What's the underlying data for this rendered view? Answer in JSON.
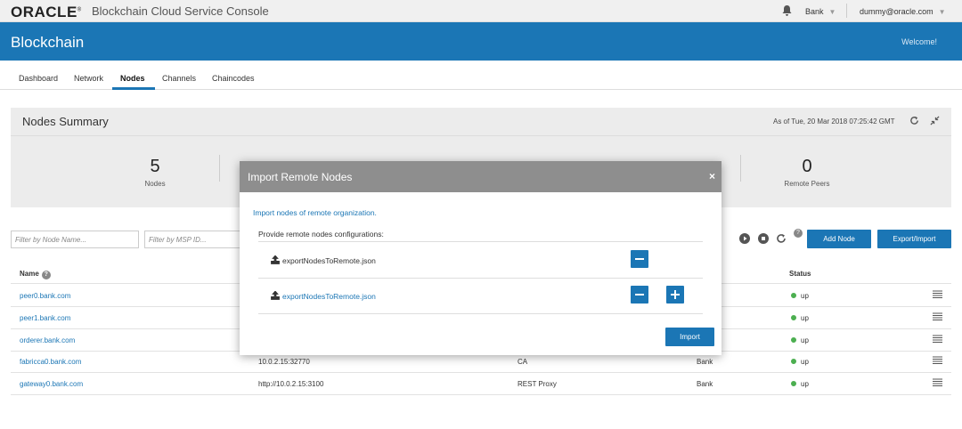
{
  "topbar": {
    "logo": "ORACLE",
    "console_title": "Blockchain Cloud Service Console",
    "org": "Bank",
    "user": "dummy@oracle.com"
  },
  "appbar": {
    "title": "Blockchain",
    "welcome": "Welcome!"
  },
  "tabs": [
    {
      "label": "Dashboard"
    },
    {
      "label": "Network"
    },
    {
      "label": "Nodes",
      "active": true
    },
    {
      "label": "Channels"
    },
    {
      "label": "Chaincodes"
    }
  ],
  "summary": {
    "title": "Nodes Summary",
    "as_of": "As of Tue, 20 Mar 2018 07:25:42 GMT",
    "stats": [
      {
        "value": "5",
        "label": "Nodes"
      },
      {
        "value": "0",
        "label": "Remote Peers"
      }
    ]
  },
  "filters": {
    "node_name_placeholder": "Filter by Node Name...",
    "msp_id_placeholder": "Filter by MSP ID..."
  },
  "actions": {
    "add_node": "Add Node",
    "export_import": "Export/Import"
  },
  "table": {
    "headers": {
      "name": "Name",
      "status": "Status"
    },
    "rows": [
      {
        "name": "peer0.bank.com",
        "address": "",
        "type": "",
        "org": "",
        "status": "up"
      },
      {
        "name": "peer1.bank.com",
        "address": "",
        "type": "",
        "org": "",
        "status": "up"
      },
      {
        "name": "orderer.bank.com",
        "address": "",
        "type": "",
        "org": "",
        "status": "up"
      },
      {
        "name": "fabricca0.bank.com",
        "address": "10.0.2.15:32770",
        "type": "CA",
        "org": "Bank",
        "status": "up"
      },
      {
        "name": "gateway0.bank.com",
        "address": "http://10.0.2.15:3100",
        "type": "REST Proxy",
        "org": "Bank",
        "status": "up"
      }
    ]
  },
  "modal": {
    "title": "Import Remote Nodes",
    "close": "×",
    "description": "Import nodes of remote organization.",
    "subtitle": "Provide remote nodes configurations:",
    "files": [
      {
        "name": "exportNodesToRemote.json"
      },
      {
        "name": "exportNodesToRemote.json"
      }
    ],
    "import_label": "Import"
  },
  "colors": {
    "brand": "#1b76b5",
    "status_up": "#4caf50",
    "modal_header": "#8e8e8e"
  }
}
